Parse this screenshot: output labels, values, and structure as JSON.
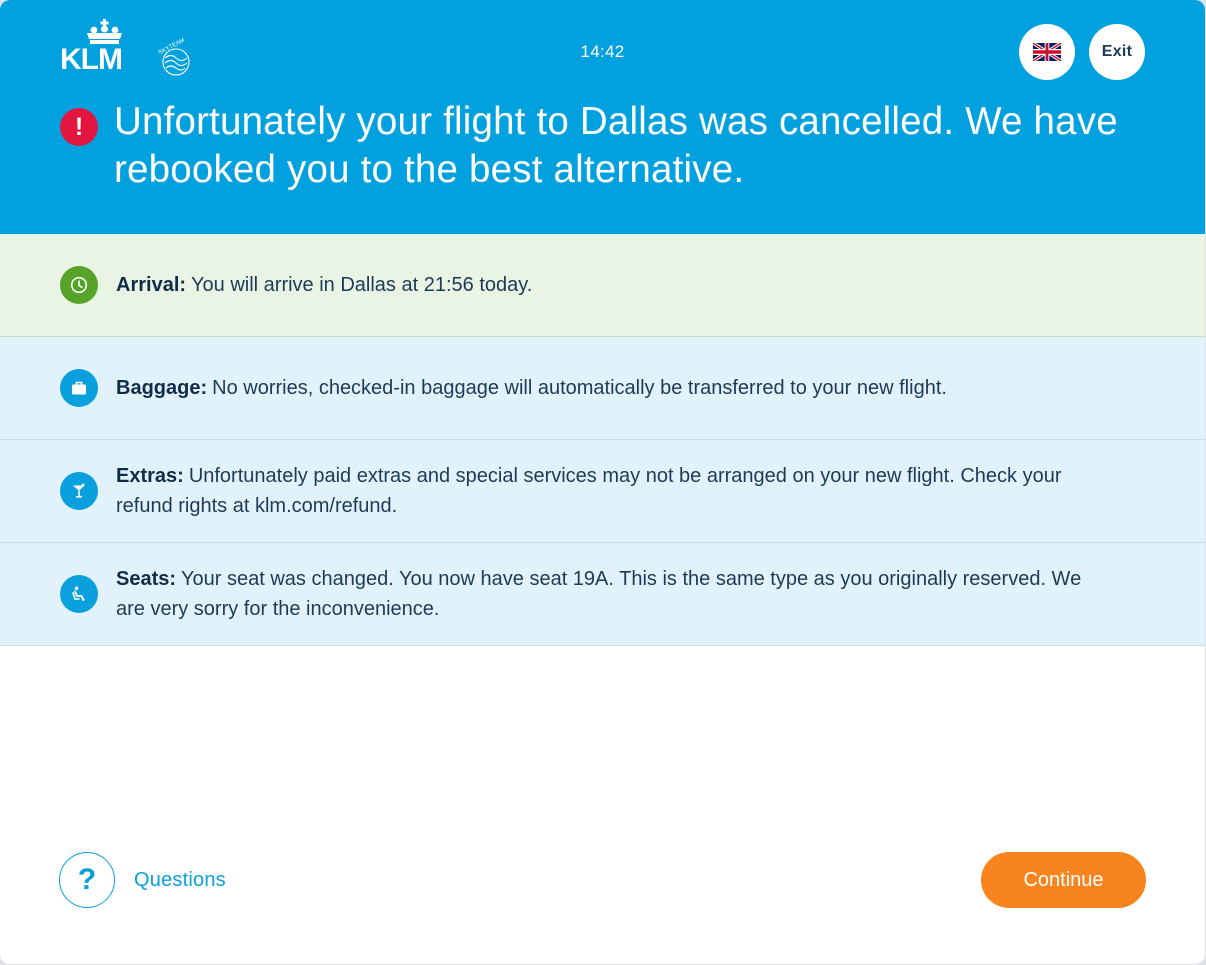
{
  "app": {
    "brand": "KLM",
    "brand_tagline": "SKYTEAM"
  },
  "header": {
    "time": "14:42",
    "language_icon": "uk-flag-icon",
    "exit_label": "Exit",
    "alert_icon": "exclamation-icon",
    "alert_glyph": "!",
    "headline": "Unfortunately your flight to Dallas was cancelled. We have rebooked you to the best alternative."
  },
  "details": [
    {
      "icon": "clock-icon",
      "label": "Arrival:",
      "text": "You will arrive in Dallas at 21:56 today.",
      "tone": "green"
    },
    {
      "icon": "briefcase-icon",
      "label": "Baggage:",
      "text": "No worries, checked-in baggage will automatically be transferred to your new flight.",
      "tone": "blue"
    },
    {
      "icon": "cocktail-icon",
      "label": "Extras:",
      "text": "Unfortunately paid extras and special services may not be arranged on your new flight. Check your refund rights at klm.com/refund.",
      "tone": "blue"
    },
    {
      "icon": "seat-icon",
      "label": "Seats:",
      "text": "Your seat was changed. You now have seat 19A. This is the same type as you originally reserved. We are very sorry for the inconvenience.",
      "tone": "blue"
    }
  ],
  "footer": {
    "questions_icon_glyph": "?",
    "questions_label": "Questions",
    "continue_label": "Continue"
  },
  "colors": {
    "header_blue": "#00a1de",
    "alert_red": "#e3163f",
    "arrival_green": "#56a329",
    "row_green_bg": "#eaf4e4",
    "row_blue_bg": "#e2f2fa",
    "continue_orange": "#f7841e",
    "text_dark": "#1d3a56"
  }
}
